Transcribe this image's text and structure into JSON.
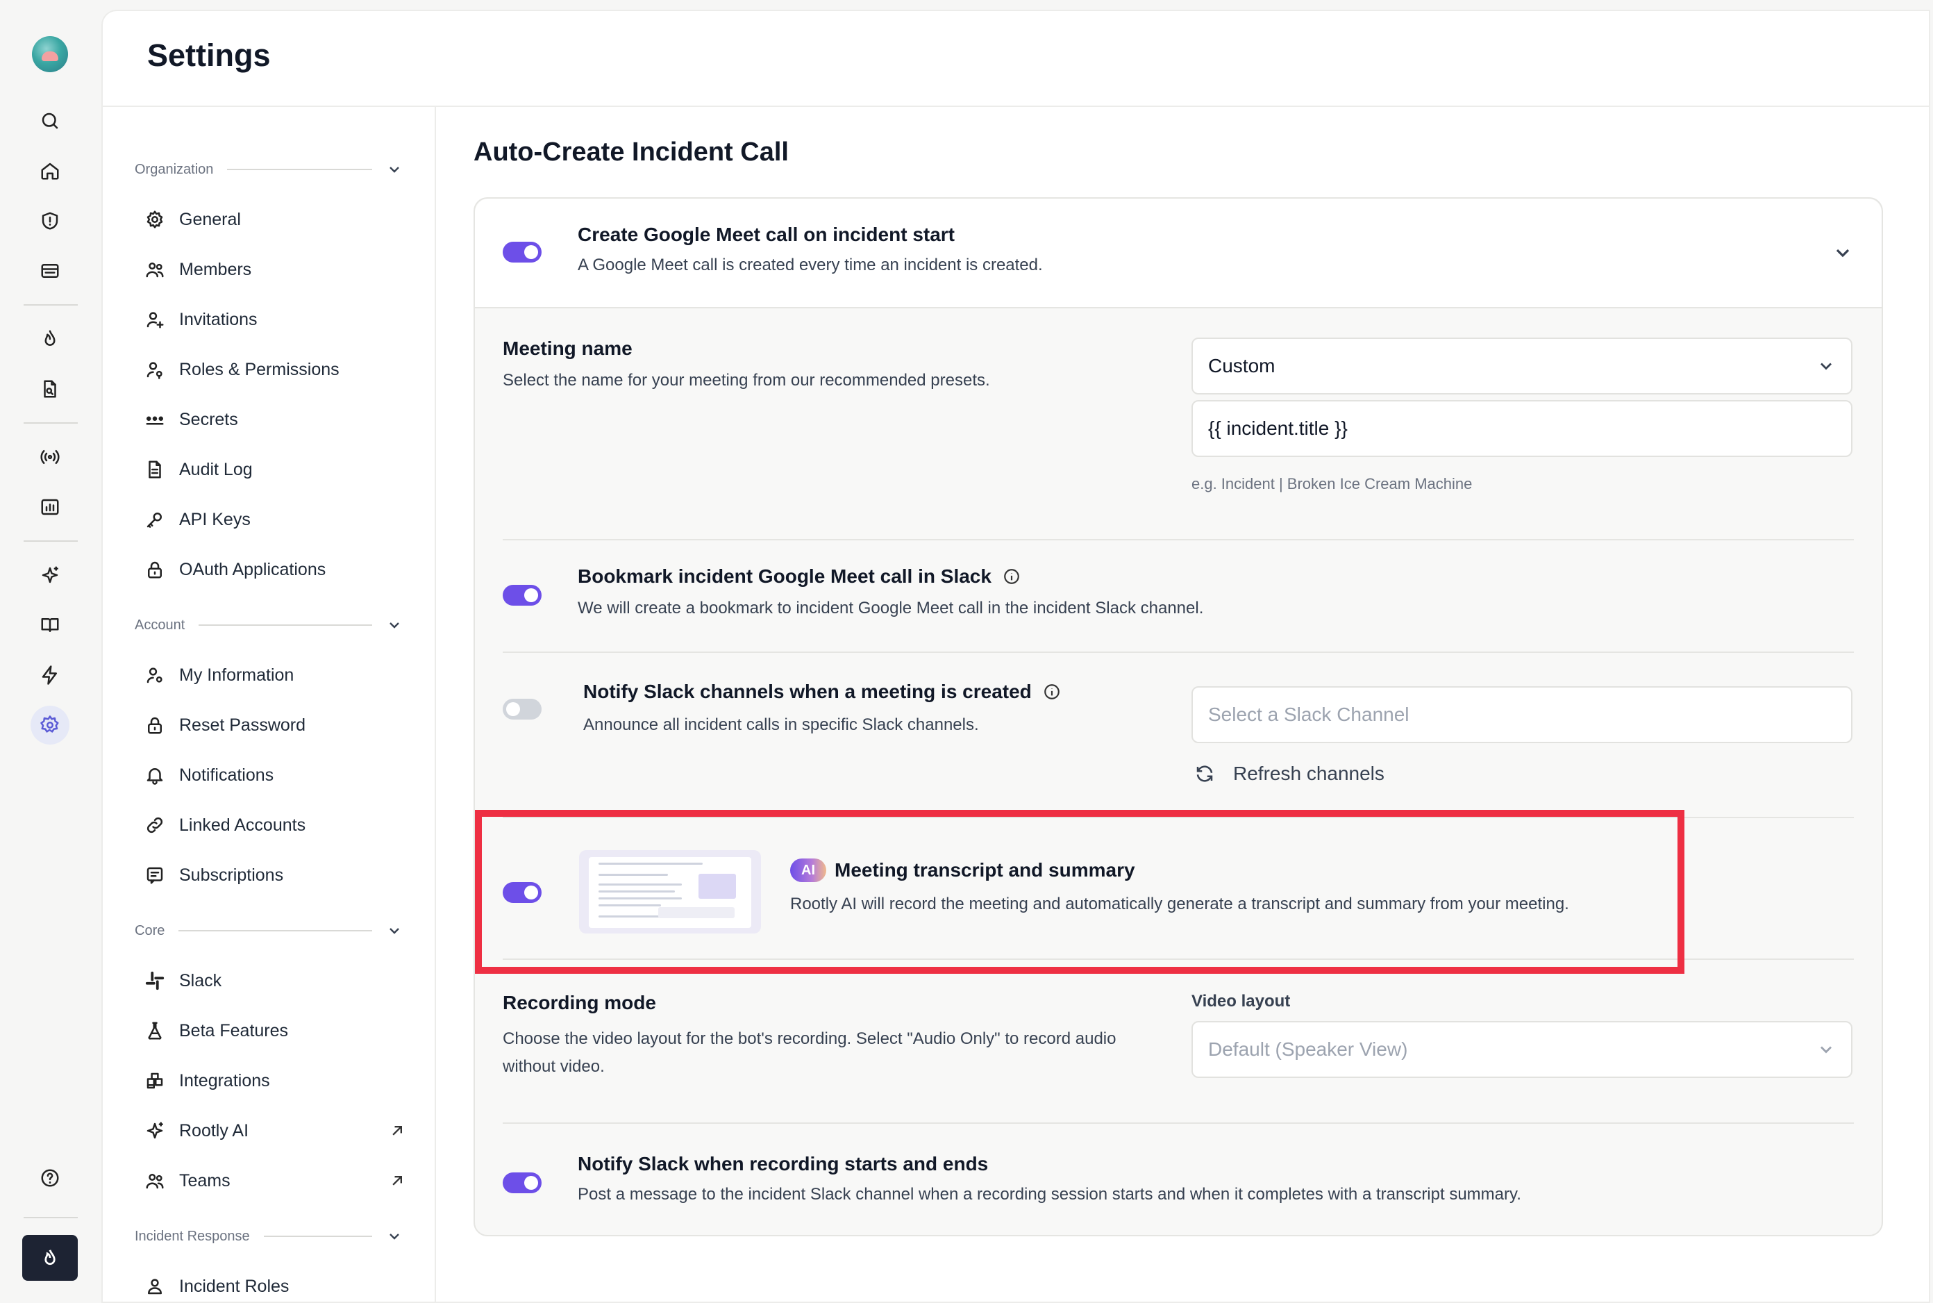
{
  "rail": {
    "icons": [
      "search-icon",
      "home-icon",
      "shield-alert-icon",
      "ticket-icon",
      "flame-icon",
      "file-search-icon",
      "broadcast-icon",
      "chart-icon",
      "sparkle-icon",
      "book-icon",
      "bolt-icon",
      "gear-icon",
      "help-icon",
      "flame-icon"
    ],
    "active": "gear-icon"
  },
  "header": {
    "title": "Settings"
  },
  "nav": {
    "organization": {
      "label": "Organization",
      "items": [
        "General",
        "Members",
        "Invitations",
        "Roles & Permissions",
        "Secrets",
        "Audit Log",
        "API Keys",
        "OAuth Applications"
      ]
    },
    "account": {
      "label": "Account",
      "items": [
        "My Information",
        "Reset Password",
        "Notifications",
        "Linked Accounts",
        "Subscriptions"
      ]
    },
    "core": {
      "label": "Core",
      "items": [
        "Slack",
        "Beta Features",
        "Integrations",
        "Rootly AI",
        "Teams"
      ]
    },
    "incident_response": {
      "label": "Incident Response",
      "items": [
        "Incident Roles"
      ]
    }
  },
  "main": {
    "section_title": "Auto-Create Incident Call",
    "create_call": {
      "title": "Create Google Meet call on incident start",
      "description": "A Google Meet call is created every time an incident is created.",
      "enabled": true
    },
    "meeting_name": {
      "title": "Meeting name",
      "description": "Select the name for your meeting from our recommended presets.",
      "preset_value": "Custom",
      "template_value": "{{ incident.title }}",
      "hint": "e.g. Incident | Broken Ice Cream Machine"
    },
    "bookmark": {
      "title": "Bookmark incident Google Meet call in Slack",
      "description": "We will create a bookmark to incident Google Meet call in the incident Slack channel.",
      "enabled": true
    },
    "notify_channels": {
      "title": "Notify Slack channels when a meeting is created",
      "description": "Announce all incident calls in specific Slack channels.",
      "channel_placeholder": "Select a Slack Channel",
      "refresh_label": "Refresh channels",
      "enabled": false
    },
    "transcript": {
      "badge": "AI",
      "title": "Meeting transcript and summary",
      "description": "Rootly AI will record the meeting and automatically generate a transcript and summary from your meeting.",
      "enabled": true
    },
    "recording_mode": {
      "title": "Recording mode",
      "description_line1": "Choose the video layout for the bot's recording. Select \"Audio Only\" to record audio",
      "description_line2": "without video.",
      "layout_label": "Video layout",
      "layout_value": "Default (Speaker View)"
    },
    "notify_recording": {
      "title": "Notify Slack when recording starts and ends",
      "description": "Post a message to the incident Slack channel when a recording session starts and when it completes with a transcript summary.",
      "enabled": true
    }
  },
  "colors": {
    "accent": "#6d4fe8",
    "highlight": "#ee2f43",
    "rail_bottom": "#1d2333"
  }
}
